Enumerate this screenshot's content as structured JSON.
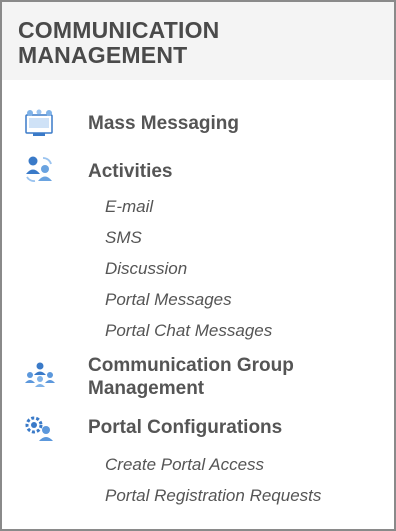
{
  "panel": {
    "title_line1": "COMMUNICATION",
    "title_line2": "MANAGEMENT"
  },
  "menu": {
    "mass_messaging": {
      "label": "Mass Messaging",
      "icon": "mass-messaging-icon"
    },
    "activities": {
      "label": "Activities",
      "icon": "activities-icon",
      "items": [
        "E-mail",
        "SMS",
        "Discussion",
        "Portal Messages",
        "Portal Chat Messages"
      ]
    },
    "communication_group": {
      "label_line1": "Communication Group",
      "label_line2": "Management",
      "icon": "communication-group-icon"
    },
    "portal_configurations": {
      "label": "Portal Configurations",
      "icon": "portal-configurations-icon",
      "items": [
        "Create Portal Access",
        "Portal Registration Requests"
      ]
    }
  },
  "colors": {
    "header_bg": "#f4f4f4",
    "text": "#555555",
    "icon_blue": "#3a7ac8",
    "border": "#8a8a8a"
  }
}
